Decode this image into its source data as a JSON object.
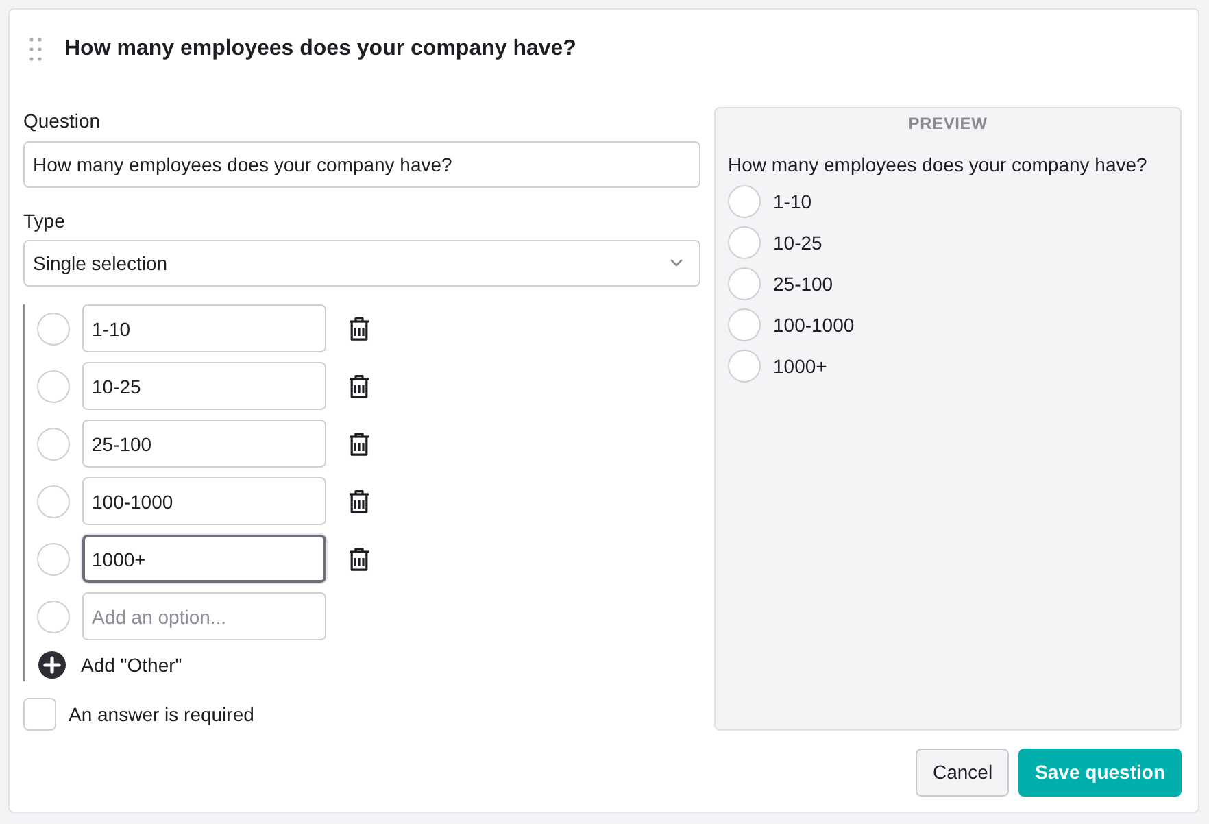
{
  "header": {
    "title": "How many employees does your company have?"
  },
  "question_field": {
    "label": "Question",
    "value": "How many employees does your company have?"
  },
  "type_field": {
    "label": "Type",
    "value": "Single selection"
  },
  "options": [
    {
      "value": "1-10",
      "focused": false
    },
    {
      "value": "10-25",
      "focused": false
    },
    {
      "value": "25-100",
      "focused": false
    },
    {
      "value": "100-1000",
      "focused": false
    },
    {
      "value": "1000+",
      "focused": true
    }
  ],
  "new_option": {
    "placeholder": "Add an option..."
  },
  "add_other": {
    "label": "Add \"Other\""
  },
  "required": {
    "label": "An answer is required",
    "checked": false
  },
  "preview": {
    "heading": "PREVIEW",
    "question": "How many employees does your company have?",
    "options": [
      {
        "label": "1-10",
        "selected": false
      },
      {
        "label": "10-25",
        "selected": false
      },
      {
        "label": "25-100",
        "selected": false
      },
      {
        "label": "100-1000",
        "selected": false
      },
      {
        "label": "1000+",
        "selected": false
      }
    ]
  },
  "buttons": [
    {
      "label": "Cancel",
      "kind": "secondary"
    },
    {
      "label": "Save question",
      "kind": "primary"
    }
  ]
}
